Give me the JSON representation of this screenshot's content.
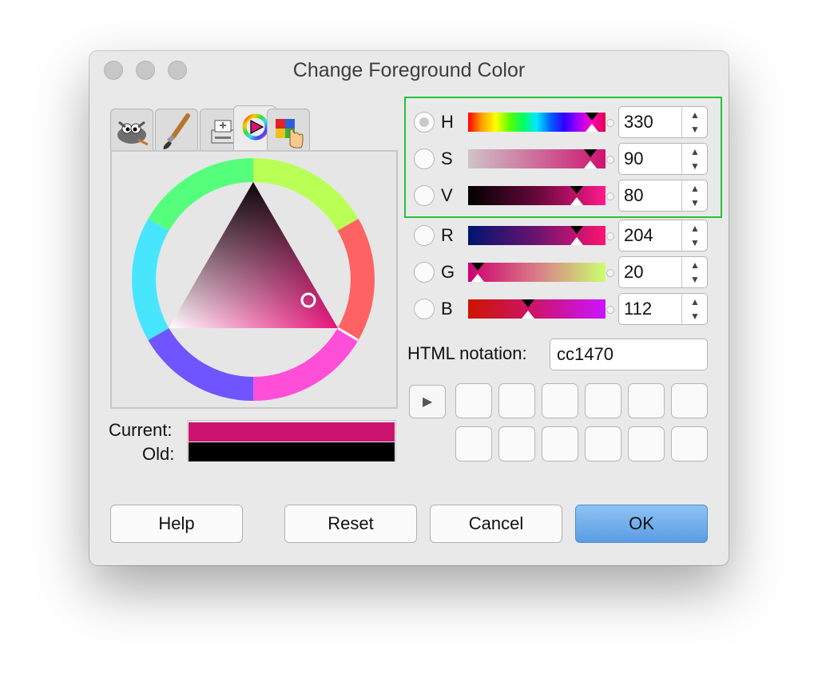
{
  "window": {
    "title": "Change Foreground Color"
  },
  "tabs": [
    {
      "name": "gimp-selector"
    },
    {
      "name": "brush-selector"
    },
    {
      "name": "scales-selector"
    },
    {
      "name": "triangle-wheel-selector",
      "active": true
    },
    {
      "name": "palette-selector"
    }
  ],
  "swatches": {
    "current_label": "Current:",
    "old_label": "Old:",
    "current_color": "#cc1470",
    "old_color": "#000000"
  },
  "channels": [
    {
      "label": "H",
      "value": "330",
      "position": 0.92,
      "checked": true
    },
    {
      "label": "S",
      "value": "90",
      "position": 0.9,
      "checked": false
    },
    {
      "label": "V",
      "value": "80",
      "position": 0.8,
      "checked": false
    },
    {
      "label": "R",
      "value": "204",
      "position": 0.8,
      "checked": false
    },
    {
      "label": "G",
      "value": "20",
      "position": 0.08,
      "checked": false
    },
    {
      "label": "B",
      "value": "112",
      "position": 0.44,
      "checked": false
    }
  ],
  "html_notation": {
    "label": "HTML notation:",
    "value": "cc1470"
  },
  "history": {
    "button_glyph": "▶",
    "slot_count": 12
  },
  "buttons": {
    "help": "Help",
    "reset": "Reset",
    "cancel": "Cancel",
    "ok": "OK"
  },
  "colors": {
    "accent_ok": "#6aaeea",
    "focus_ring": "#27c23a"
  }
}
